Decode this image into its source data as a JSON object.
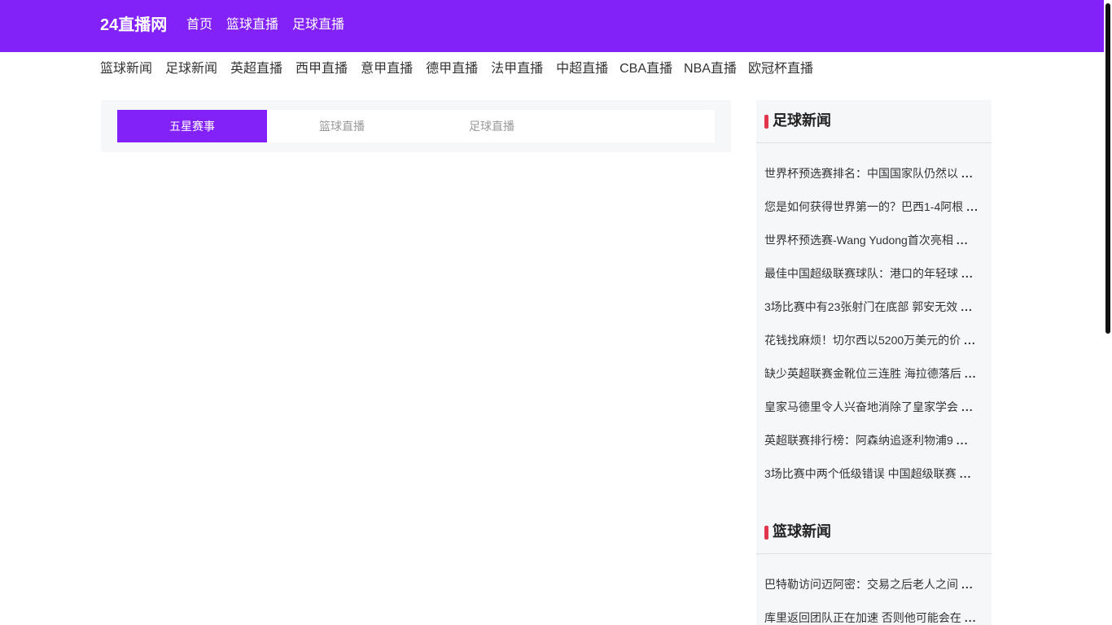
{
  "header": {
    "brand": "24直播网",
    "nav": [
      "首页",
      "篮球直播",
      "足球直播"
    ]
  },
  "subnav": [
    "篮球新闻",
    "足球新闻",
    "英超直播",
    "西甲直播",
    "意甲直播",
    "德甲直播",
    "法甲直播",
    "中超直播",
    "CBA直播",
    "NBA直播",
    "欧冠杯直播"
  ],
  "tabs": [
    "五星赛事",
    "篮球直播",
    "足球直播"
  ],
  "sidebar": {
    "football": {
      "title": "足球新闻",
      "items": [
        "世界杯预选赛排名：中国国家队仍然以",
        "您是如何获得世界第一的？巴西1-4阿根",
        "世界杯预选赛-Wang Yudong首次亮相",
        "最佳中国超级联赛球队：港口的年轻球",
        "3场比赛中有23张射门在底部 郭安无效",
        "花钱找麻烦！切尔西以5200万美元的价",
        "缺少英超联赛金靴位三连胜 海拉德落后",
        "皇家马德里令人兴奋地消除了皇家学会",
        "英超联赛排行榜：阿森纳追逐利物浦9",
        "3场比赛中两个低级错误 中国超级联赛"
      ]
    },
    "basketball": {
      "title": "篮球新闻",
      "items": [
        "巴特勒访问迈阿密：交易之后老人之间",
        "库里返回团队正在加速 否则他可能会在"
      ]
    },
    "ellipsis": "..."
  },
  "colors": {
    "brand": "#8321f9",
    "accent_bar": "#e2344a",
    "panel_bg": "#f6f7f9"
  }
}
